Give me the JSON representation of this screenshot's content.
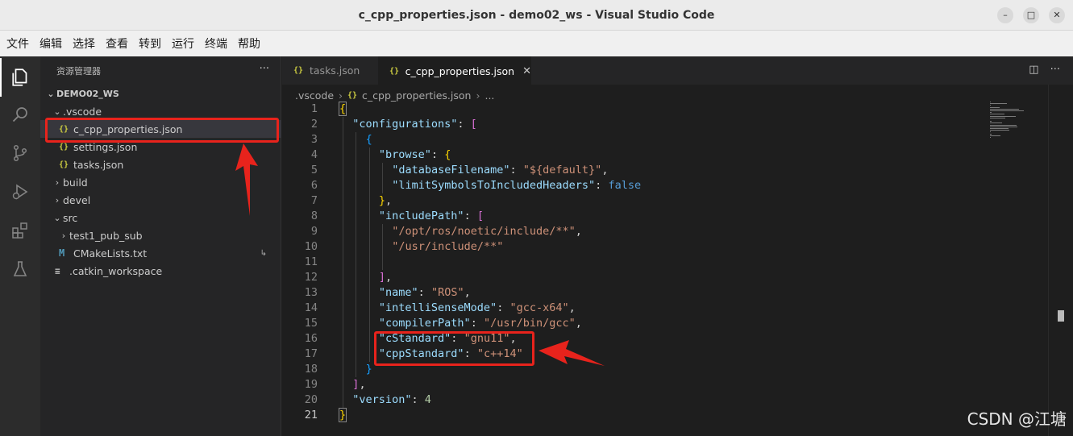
{
  "window": {
    "title": "c_cpp_properties.json - demo02_ws - Visual Studio Code",
    "controls": [
      "minimize",
      "maximize",
      "close"
    ]
  },
  "menu": [
    "文件",
    "编辑",
    "选择",
    "查看",
    "转到",
    "运行",
    "终端",
    "帮助"
  ],
  "activity_bar": [
    "explorer-icon",
    "search-icon",
    "source-control-icon",
    "run-debug-icon",
    "extensions-icon",
    "testing-icon"
  ],
  "sidebar": {
    "title": "资源管理器",
    "more": "···",
    "workspace": "DEMO02_WS",
    "tree": [
      {
        "label": ".vscode",
        "chevron": "⌄"
      },
      {
        "label": "c_cpp_properties.json",
        "icon": "{}"
      },
      {
        "label": "settings.json",
        "icon": "{}"
      },
      {
        "label": "tasks.json",
        "icon": "{}"
      },
      {
        "label": "build",
        "chevron": "›"
      },
      {
        "label": "devel",
        "chevron": "›"
      },
      {
        "label": "src",
        "chevron": "⌄"
      },
      {
        "label": "test1_pub_sub",
        "chevron": "›"
      },
      {
        "label": "CMakeLists.txt",
        "icon": "M",
        "badge": "↳"
      },
      {
        "label": ".catkin_workspace",
        "icon": "≡"
      }
    ]
  },
  "tabs": [
    {
      "label": "tasks.json",
      "icon": "{}",
      "active": false
    },
    {
      "label": "c_cpp_properties.json",
      "icon": "{}",
      "active": true,
      "close": "✕"
    }
  ],
  "breadcrumb": {
    "folder": ".vscode",
    "file_icon": "{}",
    "file": "c_cpp_properties.json",
    "sep": "›",
    "more": "..."
  },
  "code": {
    "current_line": 21,
    "lines": [
      {
        "n": "1",
        "t": "{"
      },
      {
        "n": "2",
        "t": "\"configurations\": ["
      },
      {
        "n": "3",
        "t": "{"
      },
      {
        "n": "4",
        "t": "\"browse\": {"
      },
      {
        "n": "5",
        "t": "\"databaseFilename\": \"${default}\","
      },
      {
        "n": "6",
        "t": "\"limitSymbolsToIncludedHeaders\": false"
      },
      {
        "n": "7",
        "t": "},"
      },
      {
        "n": "8",
        "t": "\"includePath\": ["
      },
      {
        "n": "9",
        "t": "\"/opt/ros/noetic/include/**\","
      },
      {
        "n": "10",
        "t": "\"/usr/include/**\""
      },
      {
        "n": "11",
        "t": ""
      },
      {
        "n": "12",
        "t": "],"
      },
      {
        "n": "13",
        "t": "\"name\": \"ROS\","
      },
      {
        "n": "14",
        "t": "\"intelliSenseMode\": \"gcc-x64\","
      },
      {
        "n": "15",
        "t": "\"compilerPath\": \"/usr/bin/gcc\","
      },
      {
        "n": "16",
        "t": "\"cStandard\": \"gnu11\","
      },
      {
        "n": "17",
        "t": "\"cppStandard\": \"c++14\""
      },
      {
        "n": "18",
        "t": "}"
      },
      {
        "n": "19",
        "t": "],"
      },
      {
        "n": "20",
        "t": "\"version\": 4"
      },
      {
        "n": "21",
        "t": "}"
      }
    ]
  },
  "watermark": "CSDN @江塘",
  "colors": {
    "annotation": "#e8231c",
    "key": "#9cdcfe",
    "string": "#ce9178",
    "keyword": "#569cd6",
    "number": "#b5cea8"
  }
}
